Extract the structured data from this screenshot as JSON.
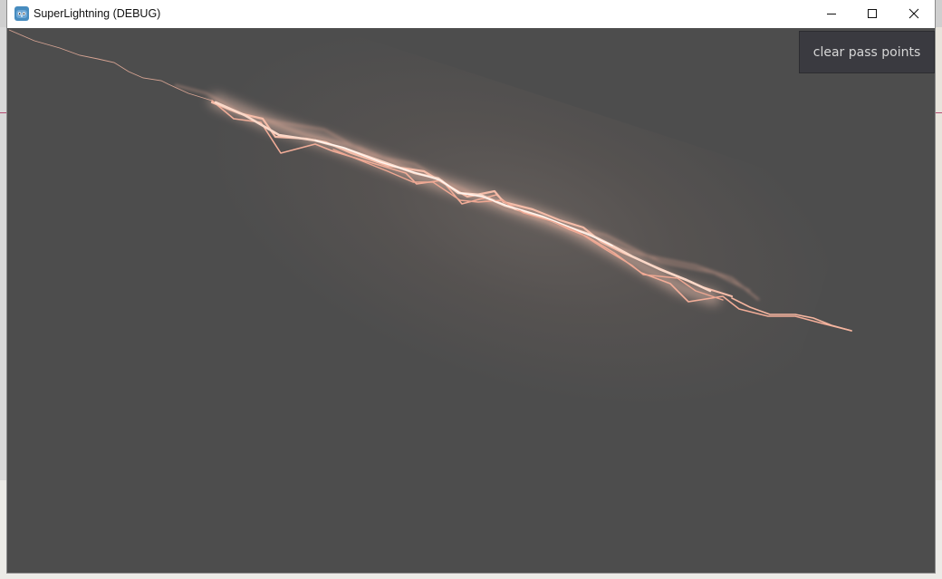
{
  "window": {
    "title": "SuperLightning (DEBUG)",
    "controls": {
      "minimize_icon": "minimize-icon",
      "maximize_icon": "maximize-icon",
      "close_icon": "close-icon"
    }
  },
  "app_icon": "godot-engine-icon",
  "viewport": {
    "background": "#4d4d4d",
    "bolt_color": "#f3b9a4",
    "bolt_core_color": "#fff4ee"
  },
  "clear_button": {
    "label": "clear pass points"
  }
}
